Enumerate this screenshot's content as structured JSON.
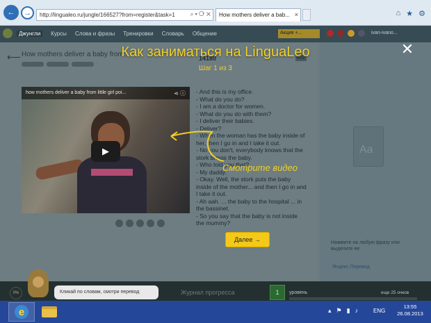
{
  "browser": {
    "url": "http://lingualeo.ru/jungle/166527?from=register&task=1",
    "tab_title": "How mothers deliver a bab...",
    "tab_close": "×"
  },
  "site": {
    "nav": [
      "Джунгли",
      "Курсы",
      "Слова и фразы",
      "Тренировки",
      "Словарь",
      "Общение"
    ],
    "promo": "Акция +...",
    "user": "ivan-ivano..."
  },
  "lesson": {
    "title": "How mothers deliver a baby from...",
    "likes": "14180",
    "stat_right": "432"
  },
  "video": {
    "title": "how mothers deliver a baby from little girl poi...",
    "play_icon": "▶"
  },
  "transcript": [
    "- And this is my office.",
    "- What do you do?",
    "- I am a doctor for women.",
    "- What do you do with them?",
    "- I deliver their babies.",
    "- Deliver?",
    "- When the woman has the baby inside of her, then I go in and I take it out.",
    "- No you don't, everybody knows that the stork brings the baby.",
    "- Who told you that?",
    "- My daddy.",
    "- Okay. Well, the stork puts the baby inside of the mother... and then I go in and I take it out.",
    "- Ah aah. ... the baby to the hospital ... in the bassinet.",
    "- So you say that the baby is not inside the mummy?"
  ],
  "right_panel": {
    "card_text": "Aa",
    "hint": "Нажмите на любую фразу или выделите ее",
    "yandex": "Яндекс.Перевод"
  },
  "bottom": {
    "percent": "0%",
    "bubble": "Кликай по словам, смотри перевод",
    "progress_link": "Журнал прогресса",
    "level_num": "1",
    "level_label": "уровень",
    "level_remaining": "еще 25 очков",
    "level_progress": 0
  },
  "overlay": {
    "title": "Как заниматься на LinguaLeo",
    "step": "Шаг 1 из 3",
    "close": "✕",
    "callout": "Смотрите видео",
    "next": "Далее →"
  },
  "taskbar": {
    "lang": "ENG",
    "time": "13:55",
    "date": "26.08.2013"
  }
}
